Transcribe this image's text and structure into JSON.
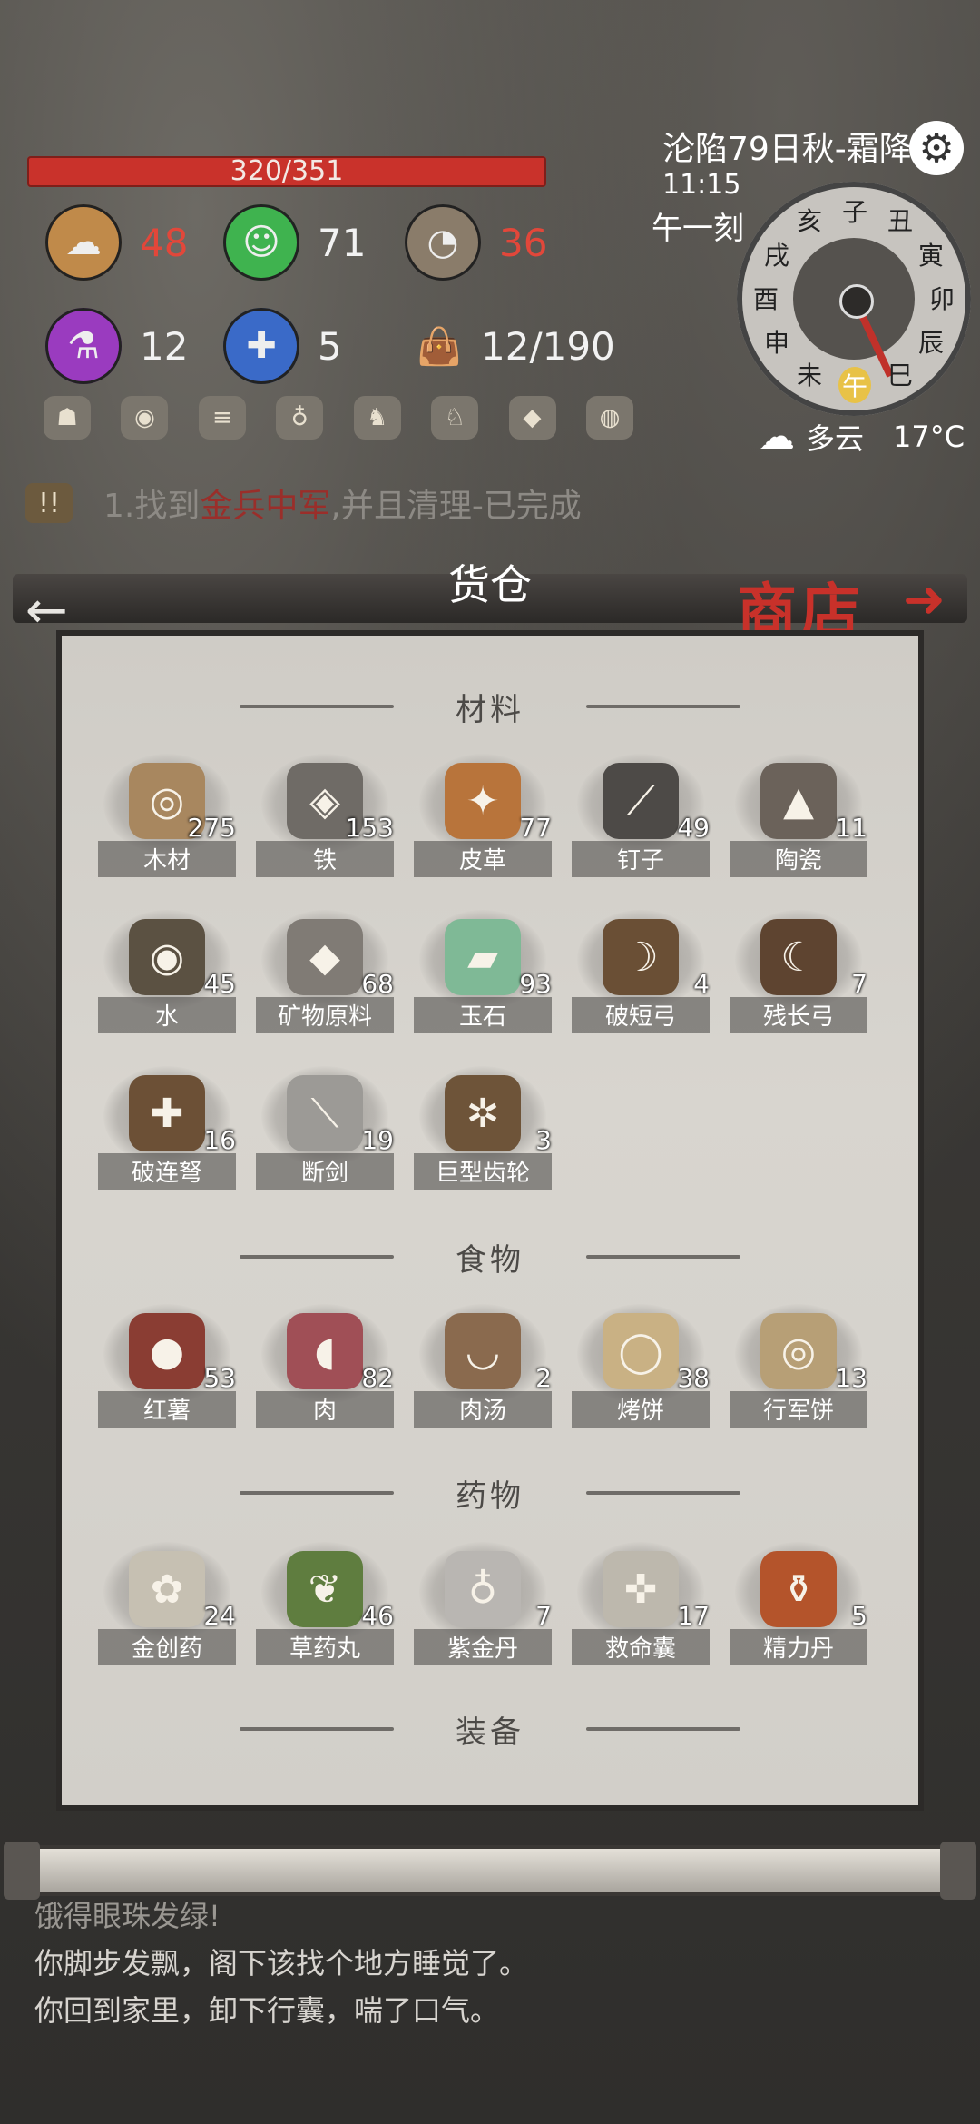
{
  "hud": {
    "hp": "320/351",
    "hp_fraction": 0.912,
    "stats": [
      {
        "icon": "brain-icon",
        "value": "48",
        "color": "#e2473a"
      },
      {
        "icon": "smile-icon",
        "value": "71",
        "color": "#f2f2f2"
      },
      {
        "icon": "stomach-icon",
        "value": "36",
        "color": "#e2473a"
      },
      {
        "icon": "potion-icon",
        "value": "12",
        "color": "#f2f2f2"
      },
      {
        "icon": "bandage-icon",
        "value": "5",
        "color": "#f2f2f2"
      },
      {
        "icon": "bag-icon",
        "value": "12/190",
        "color": "#f2f2f2"
      }
    ],
    "mini_icons": [
      "bones-icon",
      "lantern-icon",
      "coins-icon",
      "vase-icon",
      "boots-icon",
      "horse-icon",
      "sack-icon",
      "lamp-icon"
    ]
  },
  "clock": {
    "date": "沦陷79日秋-霜降",
    "time": "11:15",
    "period": "午一刻",
    "hours": [
      "亥",
      "子",
      "丑",
      "寅",
      "卯",
      "辰",
      "巳",
      "午",
      "未",
      "申",
      "酉",
      "戌"
    ],
    "current_hour": "午"
  },
  "weather": {
    "condition": "多云",
    "temp": "17°C"
  },
  "quest": {
    "prefix": "1.找到",
    "highlight": "金兵中军",
    "suffix": ",并且清理-已完成",
    "badge": "!!"
  },
  "panel": {
    "title": "货仓",
    "shop": "商店"
  },
  "sections": {
    "materials": {
      "title": "材料",
      "items": [
        {
          "name": "木材",
          "count": "275",
          "icon": "wood-icon",
          "color": "#a8875f"
        },
        {
          "name": "铁",
          "count": "153",
          "icon": "iron-ore-icon",
          "color": "#6f6b66"
        },
        {
          "name": "皮革",
          "count": "77",
          "icon": "leather-icon",
          "color": "#b8743b"
        },
        {
          "name": "钉子",
          "count": "49",
          "icon": "nails-icon",
          "color": "#4d4a47"
        },
        {
          "name": "陶瓷",
          "count": "11",
          "icon": "ceramic-icon",
          "color": "#6b625a"
        },
        {
          "name": "水",
          "count": "45",
          "icon": "water-bowl-icon",
          "color": "#5b5142"
        },
        {
          "name": "矿物原料",
          "count": "68",
          "icon": "mineral-icon",
          "color": "#807b75"
        },
        {
          "name": "玉石",
          "count": "93",
          "icon": "jade-icon",
          "color": "#7fb996"
        },
        {
          "name": "破短弓",
          "count": "4",
          "icon": "broken-bow-icon",
          "color": "#6a4f35"
        },
        {
          "name": "残长弓",
          "count": "7",
          "icon": "longbow-icon",
          "color": "#5e4430"
        },
        {
          "name": "破连弩",
          "count": "16",
          "icon": "crossbow-icon",
          "color": "#6c5036"
        },
        {
          "name": "断剑",
          "count": "19",
          "icon": "broken-sword-icon",
          "color": "#9c9a96"
        },
        {
          "name": "巨型齿轮",
          "count": "3",
          "icon": "gear-wheel-icon",
          "color": "#6e5439"
        }
      ]
    },
    "food": {
      "title": "食物",
      "items": [
        {
          "name": "红薯",
          "count": "53",
          "icon": "sweet-potato-icon",
          "color": "#8a3d33"
        },
        {
          "name": "肉",
          "count": "82",
          "icon": "ham-icon",
          "color": "#a04f56"
        },
        {
          "name": "肉汤",
          "count": "2",
          "icon": "soup-icon",
          "color": "#8a6a4e"
        },
        {
          "name": "烤饼",
          "count": "38",
          "icon": "flatbread-icon",
          "color": "#c9b184"
        },
        {
          "name": "行军饼",
          "count": "13",
          "icon": "ration-cake-icon",
          "color": "#b79f76"
        }
      ]
    },
    "medicine": {
      "title": "药物",
      "items": [
        {
          "name": "金创药",
          "count": "24",
          "icon": "powder-icon",
          "color": "#c6c0b2"
        },
        {
          "name": "草药丸",
          "count": "46",
          "icon": "herb-pill-icon",
          "color": "#5f7d3f"
        },
        {
          "name": "紫金丹",
          "count": "7",
          "icon": "bottle-icon",
          "color": "#b9b6b2"
        },
        {
          "name": "救命囊",
          "count": "17",
          "icon": "rescue-kit-icon",
          "color": "#bdb8ad"
        },
        {
          "name": "精力丹",
          "count": "5",
          "icon": "energy-jar-icon",
          "color": "#b4542b"
        }
      ]
    },
    "equipment": {
      "title": "装备"
    }
  },
  "log": {
    "line1": "饿得眼珠发绿!",
    "line2": "你脚步发飘，阁下该找个地方睡觉了。",
    "line3": "你回到家里，卸下行囊，喘了口气。"
  }
}
